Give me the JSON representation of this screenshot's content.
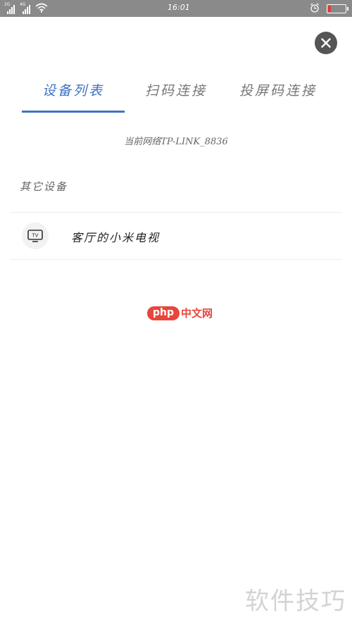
{
  "status_bar": {
    "sim1_tag": "2G",
    "sim2_tag": "4G",
    "time": "16:01",
    "battery_level": 0.15,
    "battery_color": "#e53935",
    "icons": [
      "signal-icon",
      "wifi-icon",
      "alarm-icon",
      "battery-icon"
    ]
  },
  "close_icon": "close-icon",
  "tabs": [
    {
      "label": "设备列表",
      "active": true
    },
    {
      "label": "扫码连接",
      "active": false
    },
    {
      "label": "投屏码连接",
      "active": false
    }
  ],
  "accent_color": "#3d73c4",
  "network_text": "当前网络TP-LINK_8836",
  "section_title": "其它设备",
  "devices": [
    {
      "icon_text": "TV",
      "icon": "tv-icon",
      "name": "客厅的小米电视"
    }
  ],
  "php_logo": {
    "pill": "php",
    "text": "中文网"
  },
  "watermark": "软件技巧"
}
